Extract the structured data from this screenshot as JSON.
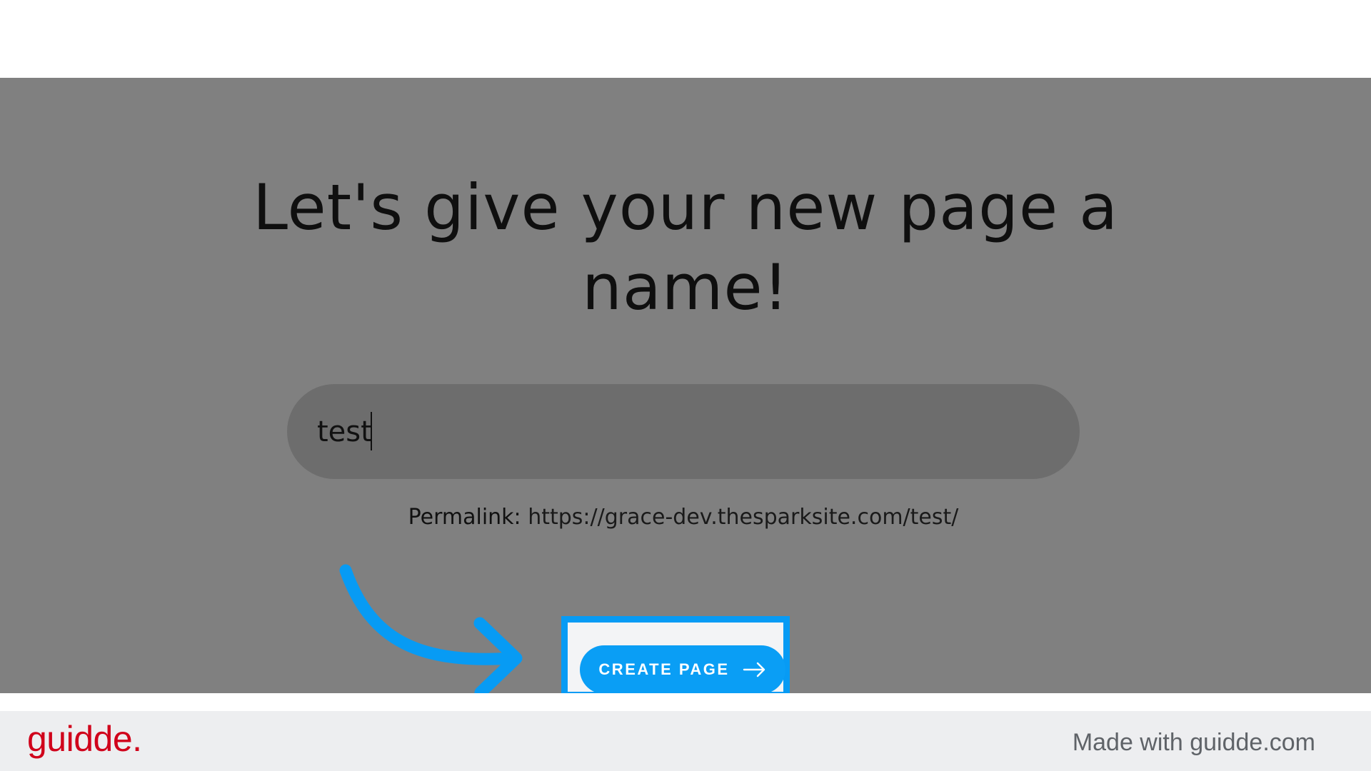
{
  "heading": "Let's give your new page a name!",
  "name_field": {
    "value": "test"
  },
  "permalink": {
    "label": "Permalink:",
    "url": "https://grace-dev.thesparksite.com/test/"
  },
  "create_button": {
    "label": "CREATE PAGE",
    "icon": "arrow-right-icon"
  },
  "annotation": {
    "icon": "curved-pointer-arrow-icon",
    "color": "#079bf4"
  },
  "footer": {
    "brand": "guidde.",
    "made_with": "Made with guidde.com",
    "brand_color": "#d0021b"
  },
  "colors": {
    "overlay": "#808080",
    "button": "#0a9ef5"
  }
}
